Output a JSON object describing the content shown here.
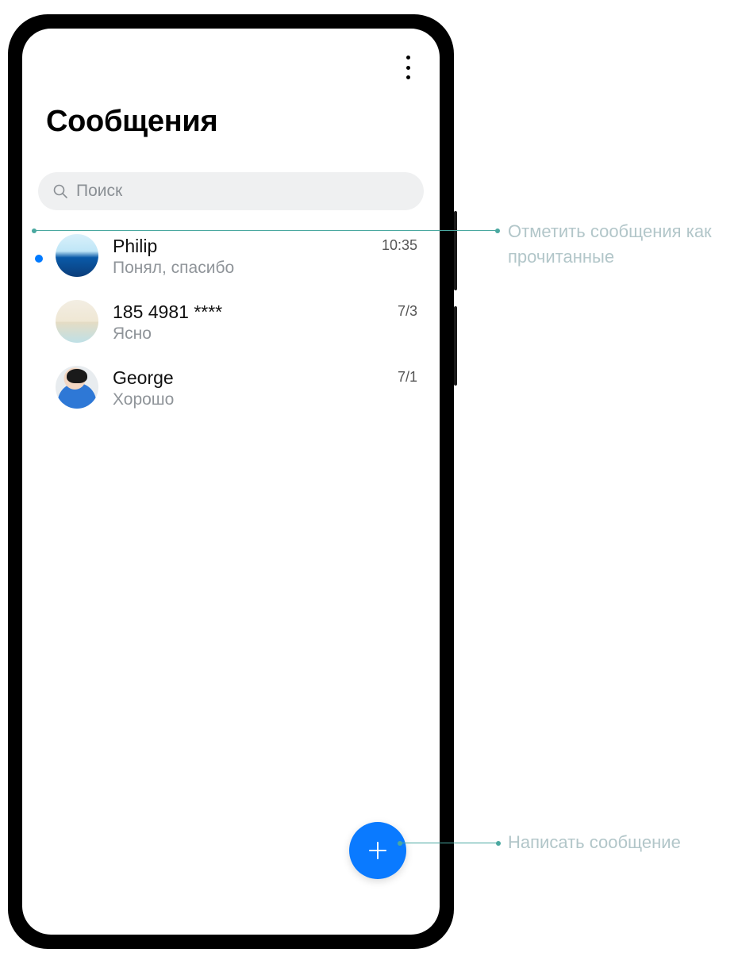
{
  "app": {
    "title": "Сообщения"
  },
  "search": {
    "placeholder": "Поиск"
  },
  "conversations": [
    {
      "name": "Philip",
      "preview": "Понял, спасибо",
      "time": "10:35",
      "unread": true,
      "avatar": "water"
    },
    {
      "name": "185 4981 ****",
      "preview": "Ясно",
      "time": "7/3",
      "unread": false,
      "avatar": "beach"
    },
    {
      "name": "George",
      "preview": "Хорошо",
      "time": "7/1",
      "unread": false,
      "avatar": "person"
    }
  ],
  "callouts": {
    "mark_read": "Отметить сообщения как прочитанные",
    "compose": "Написать сообщение"
  },
  "colors": {
    "accent": "#0a7aff",
    "leader": "#4aa8a0",
    "callout_text": "#b2c6c9"
  }
}
